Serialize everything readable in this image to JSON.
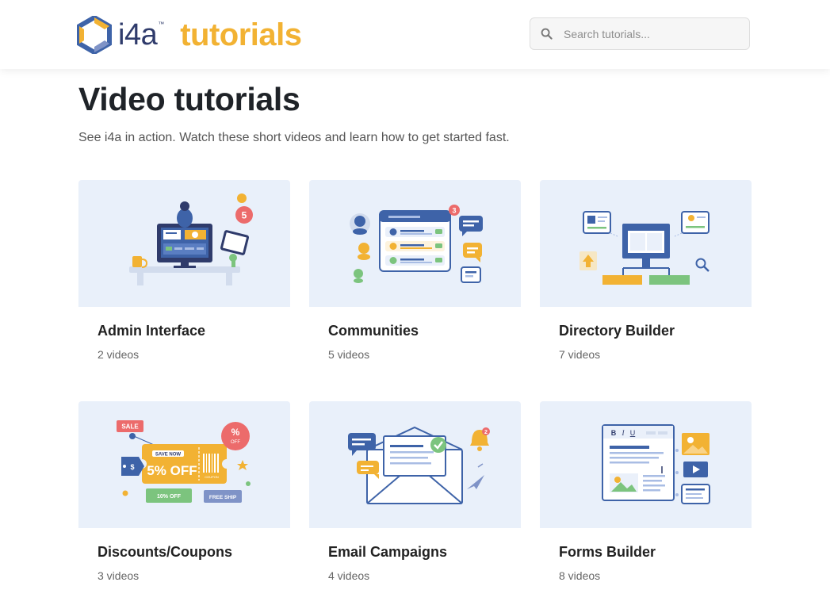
{
  "brand": {
    "logo_main": "i4a",
    "logo_tm": "™",
    "logo_suffix": "tutorials"
  },
  "search": {
    "placeholder": "Search tutorials..."
  },
  "page": {
    "title": "Video tutorials",
    "subtitle": "See i4a in action. Watch these short videos and learn how to get started fast."
  },
  "cards": [
    {
      "title": "Admin Interface",
      "count": "2 videos",
      "art": {
        "badge": "5"
      }
    },
    {
      "title": "Communities",
      "count": "5 videos",
      "art": {
        "badge": "3"
      }
    },
    {
      "title": "Directory Builder",
      "count": "7 videos"
    },
    {
      "title": "Discounts/Coupons",
      "count": "3 videos",
      "art": {
        "sale": "SALE",
        "save_now": "SAVE NOW",
        "offer": "5% OFF",
        "barcode_code": "COUPON",
        "percent": "%",
        "off": "OFF",
        "dollar": "$",
        "ten_off": "10% OFF",
        "free_ship": "FREE SHIP"
      }
    },
    {
      "title": "Email Campaigns",
      "count": "4 videos",
      "art": {
        "badge": "2"
      }
    },
    {
      "title": "Forms Builder",
      "count": "8 videos",
      "art": {
        "bold": "B",
        "italic": "I",
        "underline": "U"
      }
    }
  ],
  "colors": {
    "accent": "#f2b233",
    "navy": "#2f3b6b",
    "card_bg": "#e9f0fa"
  },
  "icons": [
    "i4a-logo-icon",
    "search-icon"
  ]
}
